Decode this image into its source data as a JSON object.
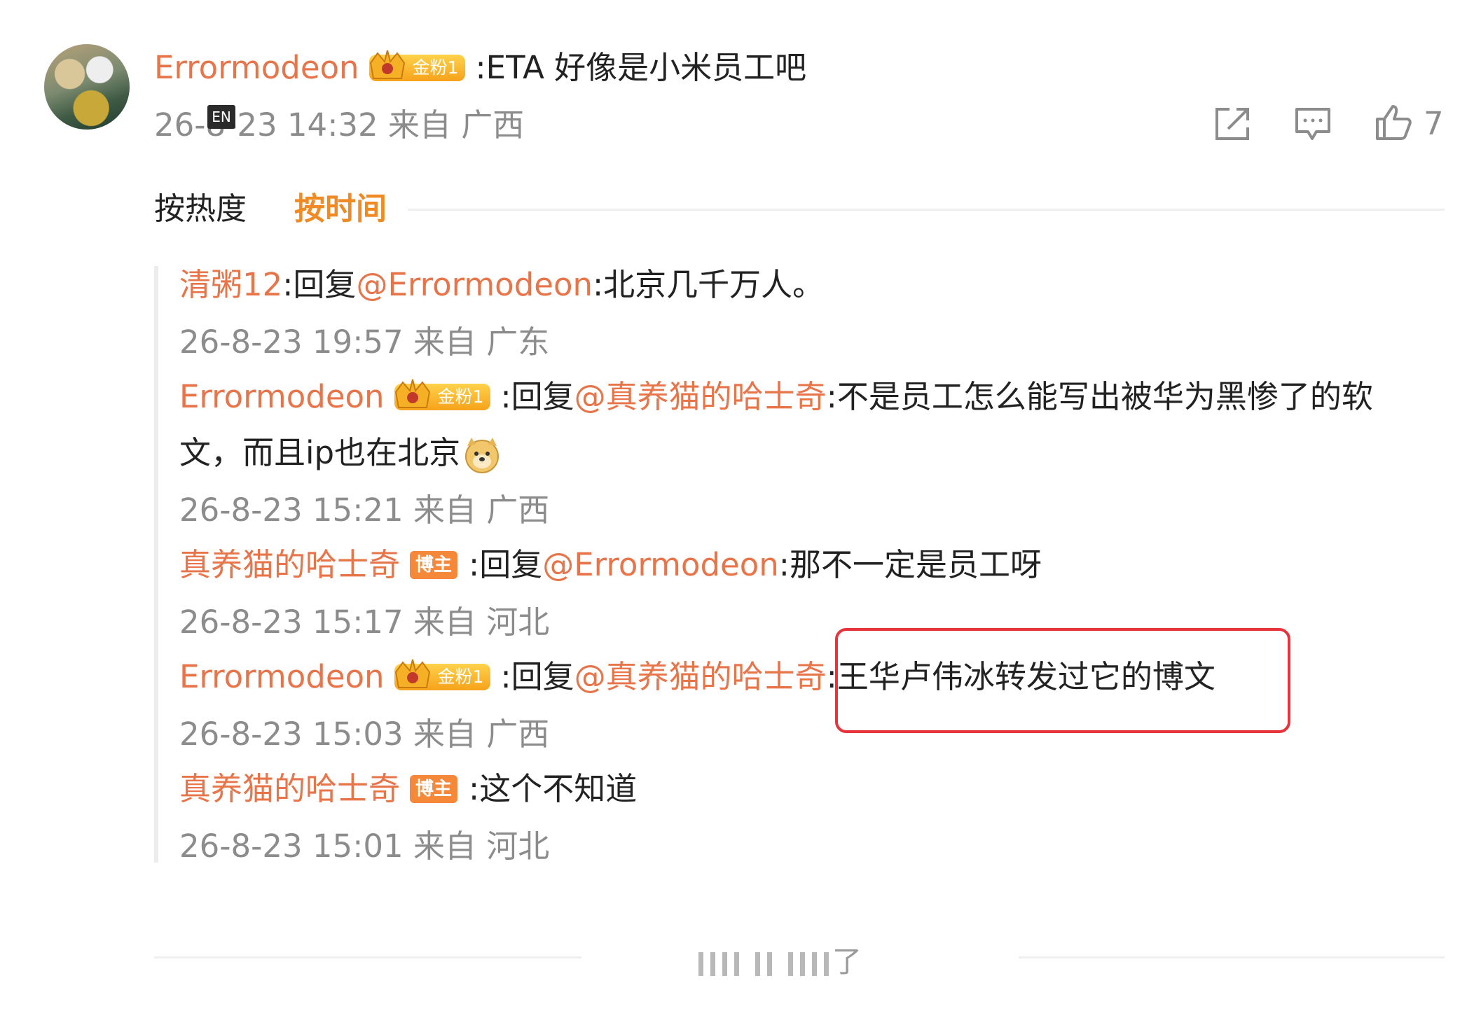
{
  "comment": {
    "author": "Errormodeon",
    "badge": "金粉1",
    "text": ":ETA 好像是小米员工吧",
    "time": "26-8-23 14:32 来自 广西",
    "like_count": "7",
    "lang_tag": "EN"
  },
  "sort_tabs": {
    "hot": "按热度",
    "time": "按时间"
  },
  "replies": [
    {
      "author": "清粥12",
      "badge": "",
      "prefix": ":回复",
      "mention": "@Errormodeon",
      "text": ":北京几千万人。",
      "time": "26-8-23 19:57 来自 广东"
    },
    {
      "author": "Errormodeon",
      "badge": "金粉1",
      "prefix": ":回复",
      "mention": "@真养猫的哈士奇",
      "text_line1": ":不是员工怎么能写出被华为黑惨了的软",
      "text_line2": "文，而且ip也在北京",
      "time": "26-8-23 15:21 来自 广西"
    },
    {
      "author": "真养猫的哈士奇",
      "badge": "博主",
      "prefix": ":回复",
      "mention": "@Errormodeon",
      "text": ":那不一定是员工呀",
      "time": "26-8-23 15:17 来自 河北"
    },
    {
      "author": "Errormodeon",
      "badge": "金粉1",
      "prefix": ":回复",
      "mention": "@真养猫的哈士奇",
      "text": ":王华卢伟冰转发过它的博文",
      "time": "26-8-23 15:03 来自 广西"
    },
    {
      "author": "真养猫的哈士奇",
      "badge": "博主",
      "text": ":这个不知道",
      "time": "26-8-23 15:01 来自 河北"
    }
  ],
  "footer": {
    "end_text": "了"
  },
  "colors": {
    "name": "#e8744a",
    "meta": "#8c8c8c",
    "active_tab": "#f08a24",
    "highlight_box": "#e8323c"
  }
}
